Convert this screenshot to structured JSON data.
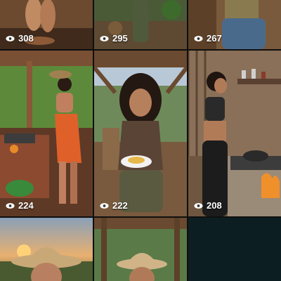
{
  "grid": {
    "items": [
      {
        "views": "308"
      },
      {
        "views": "295"
      },
      {
        "views": "267"
      },
      {
        "views": "224"
      },
      {
        "views": "222"
      },
      {
        "views": "208"
      },
      {
        "views": ""
      },
      {
        "views": ""
      }
    ]
  },
  "icons": {
    "views": "eye-icon"
  },
  "colors": {
    "background": "#0f0f0f",
    "empty_cell": "#0d1e22",
    "text": "#ffffff"
  }
}
